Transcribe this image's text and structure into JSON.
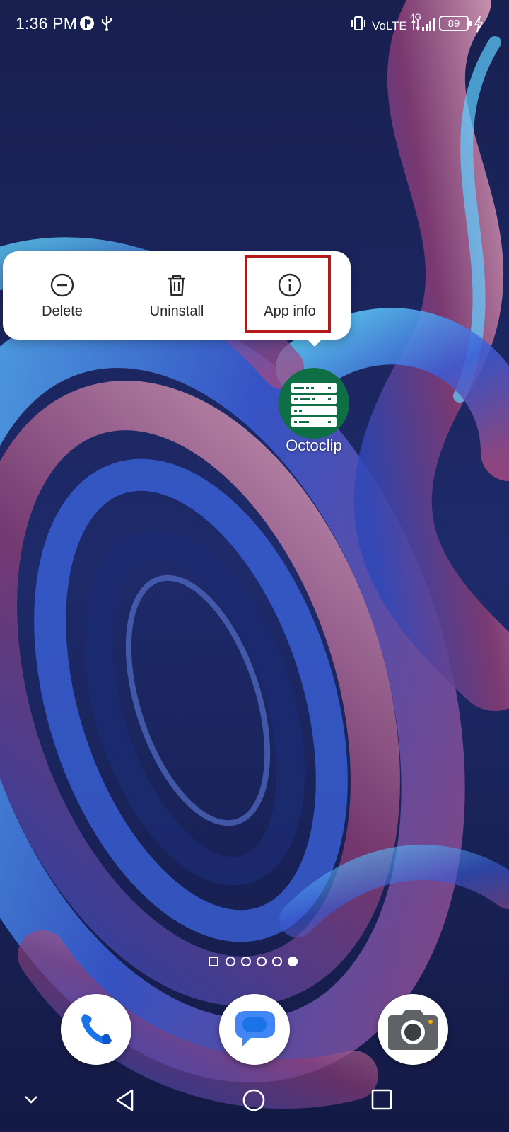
{
  "status_bar": {
    "time": "1:36 PM",
    "network_label": "VoLTE",
    "network_gen": "4G",
    "battery_level": "89",
    "icons": [
      "app-notification-icon",
      "usb-icon",
      "vibrate-icon",
      "signal-icon",
      "battery-icon",
      "charging-icon"
    ]
  },
  "popup_menu": {
    "items": [
      {
        "label": "Delete",
        "icon": "minus-circle-icon"
      },
      {
        "label": "Uninstall",
        "icon": "trash-icon"
      },
      {
        "label": "App info",
        "icon": "info-icon"
      }
    ],
    "highlighted_item": "App info",
    "highlight_color": "#b41818"
  },
  "app": {
    "name": "Octoclip",
    "icon": "server-list-icon",
    "icon_color": "#0e6f44"
  },
  "page_indicator": {
    "pages": 6,
    "active_index": 5
  },
  "dock": {
    "apps": [
      {
        "name": "phone",
        "icon": "phone-icon"
      },
      {
        "name": "messages",
        "icon": "chat-bubble-icon"
      },
      {
        "name": "camera",
        "icon": "camera-icon"
      }
    ]
  },
  "nav_bar": {
    "buttons": [
      "collapse-chevron-icon",
      "back-icon",
      "home-icon",
      "recents-icon"
    ]
  }
}
